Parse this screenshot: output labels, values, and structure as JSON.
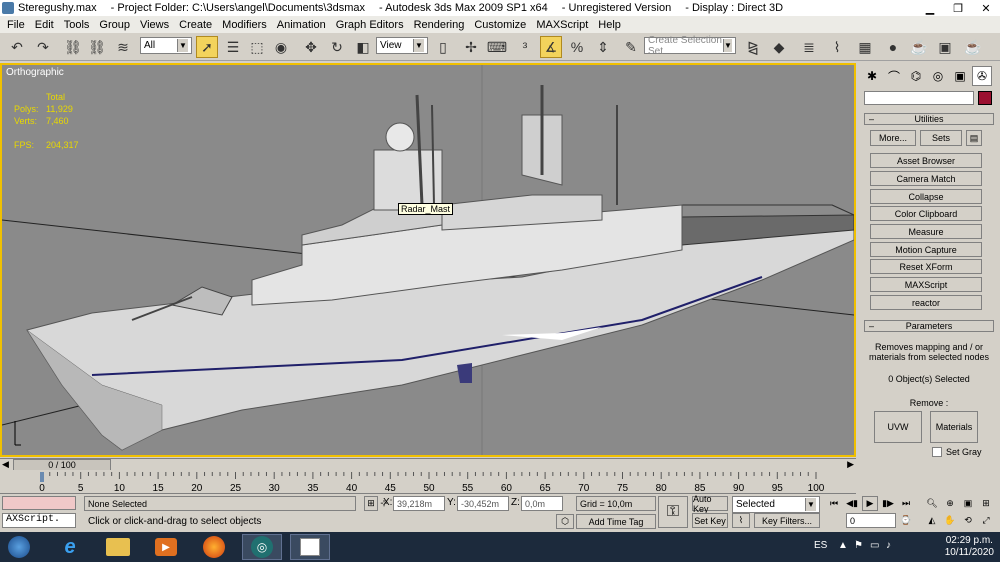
{
  "titlebar": {
    "filename": "Steregushy.max",
    "project": "- Project Folder: C:\\Users\\angel\\Documents\\3dsmax",
    "app": "- Autodesk 3ds Max  2009 SP1  x64",
    "license": "- Unregistered Version",
    "display": "- Display : Direct 3D",
    "min": "▁",
    "max": "❐",
    "close": "✕"
  },
  "menu": [
    "File",
    "Edit",
    "Tools",
    "Group",
    "Views",
    "Create",
    "Modifiers",
    "Animation",
    "Graph Editors",
    "Rendering",
    "Customize",
    "MAXScript",
    "Help"
  ],
  "toolbar": {
    "selection_filter": "All",
    "ref_coord": "View",
    "named_selection_placeholder": "Create Selection Set"
  },
  "viewport": {
    "label": "Orthographic",
    "stats": {
      "total_label": "Total",
      "polys_label": "Polys:",
      "polys_value": "11,929",
      "verts_label": "Verts:",
      "verts_value": "7,460",
      "fps_label": "FPS:",
      "fps_value": "204,317"
    },
    "tooltip": "Radar_Mast"
  },
  "cmdpanel": {
    "utilities_title": "Utilities",
    "more_label": "More...",
    "sets_label": "Sets",
    "buttons": [
      "Asset Browser",
      "Camera Match",
      "Collapse",
      "Color Clipboard",
      "Measure",
      "Motion Capture",
      "Reset XForm",
      "MAXScript",
      "reactor"
    ],
    "parameters_title": "Parameters",
    "description": "Removes mapping and / or materials from selected nodes",
    "selected_count": "0 Object(s) Selected",
    "remove_label": "Remove :",
    "uvw_label": "UVW",
    "materials_label": "Materials",
    "setgray_label": "Set Gray"
  },
  "timeslider": {
    "position": "0 / 100",
    "ticks": [
      "0",
      "5",
      "10",
      "15",
      "20",
      "25",
      "30",
      "35",
      "40",
      "45",
      "50",
      "55",
      "60",
      "65",
      "70",
      "75",
      "80",
      "85",
      "90",
      "95",
      "100"
    ]
  },
  "status": {
    "maxscript_listener": "AXScript.",
    "selection": "None Selected",
    "prompt": "Click or click-and-drag to select objects",
    "x_label": "X:",
    "x_value": "39,218m",
    "y_label": "Y:",
    "y_value": "-30,452m",
    "z_label": "Z:",
    "z_value": "0,0m",
    "grid": "Grid = 10,0m",
    "add_time_tag": "Add Time Tag",
    "auto_key": "Auto Key",
    "set_key": "Set Key",
    "selected_dropdown": "Selected",
    "key_filters": "Key Filters...",
    "frame_value": "0"
  },
  "taskbar": {
    "lang": "ES",
    "time": "02:29 p.m.",
    "date": "10/11/2020"
  },
  "colors": {
    "viewport_bg": "#8a8a8a",
    "active_border": "#f0c000",
    "stats_text": "#e8d800",
    "taskbar_bg": "#1c2a3c"
  }
}
